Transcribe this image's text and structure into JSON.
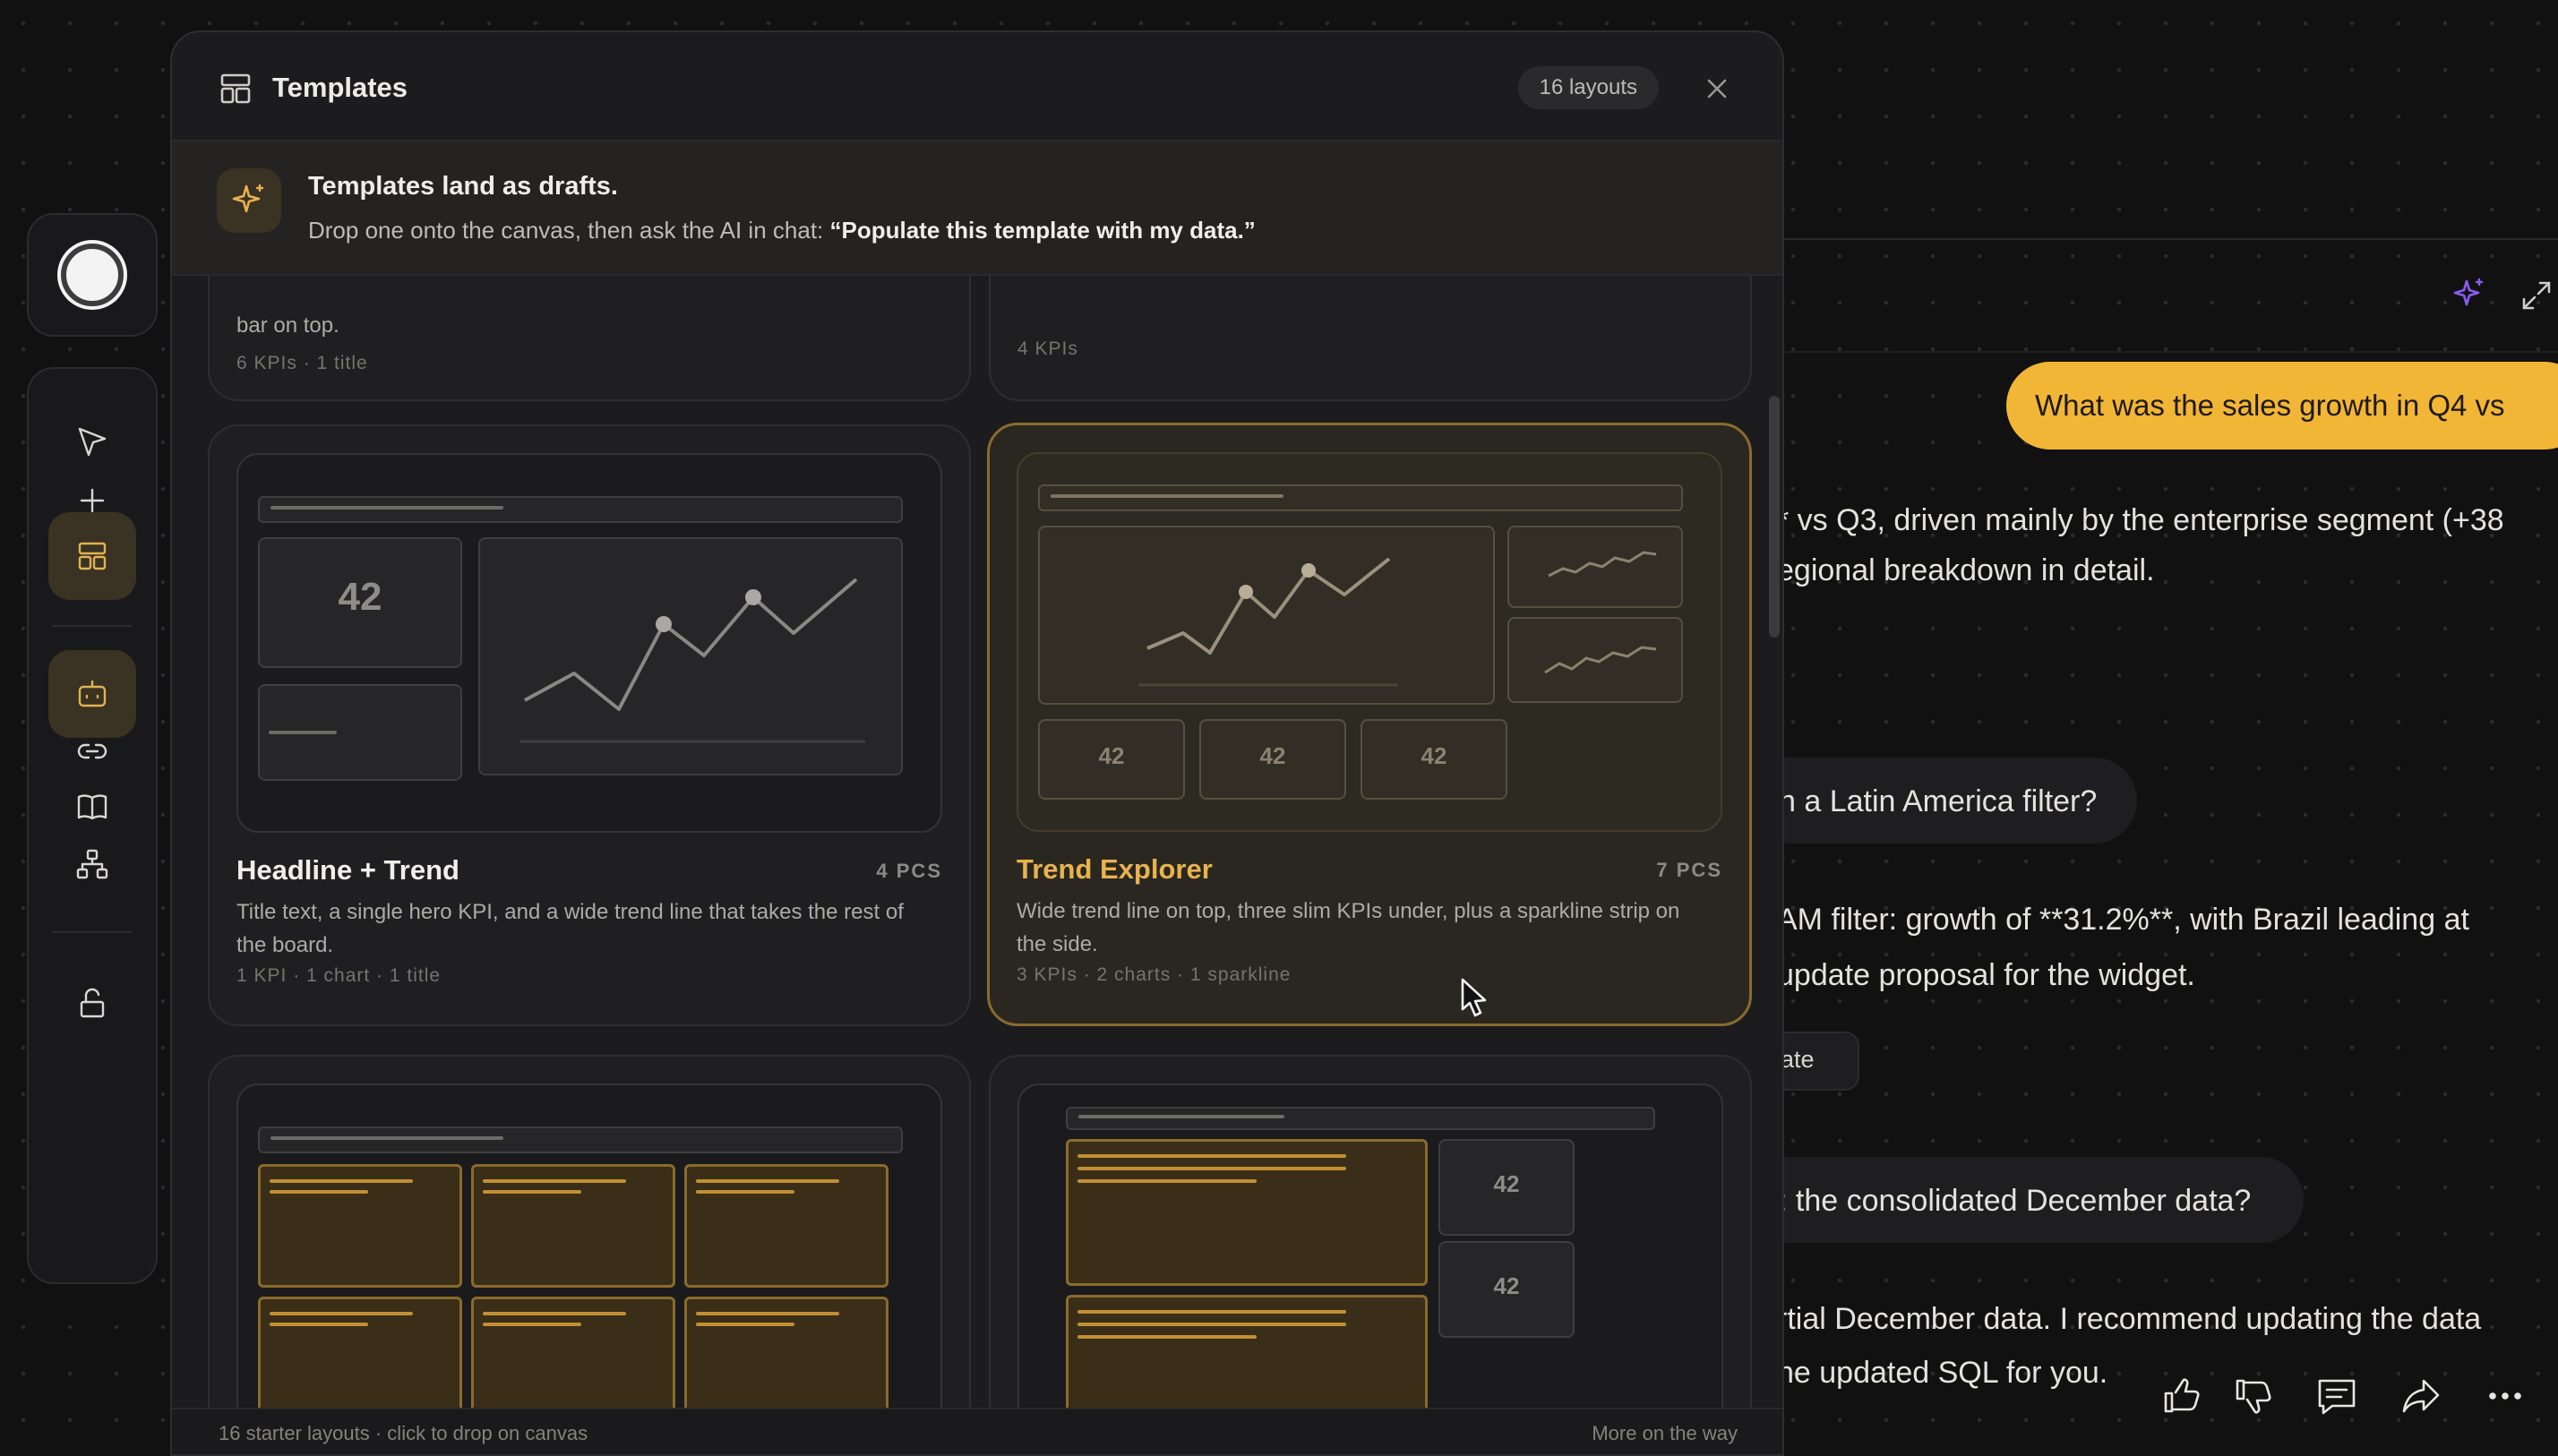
{
  "modal": {
    "title": "Templates",
    "layout_count": "16 layouts",
    "banner_title": "Templates land as drafts.",
    "banner_text": "Drop one onto the canvas, then ask the AI in chat:",
    "banner_quote": "“Populate this template with my data.”",
    "footer_left": "16 starter layouts · click to drop on canvas",
    "footer_right": "More on the way"
  },
  "partial_cards": [
    {
      "desc_tail": "bar on top.",
      "meta": "6 KPIs · 1 title"
    },
    {
      "meta": "4 KPIs"
    }
  ],
  "cards": [
    {
      "title": "Headline + Trend",
      "pieces": "4 PCS",
      "desc": "Title text, a single hero KPI, and a wide trend line that takes the rest of the board.",
      "meta": "1 KPI · 1 chart · 1 title",
      "kpi": "42"
    },
    {
      "title": "Trend Explorer",
      "pieces": "7 PCS",
      "desc": "Wide trend line on top, three slim KPIs under, plus a sparkline strip on the side.",
      "meta": "3 KPIs · 2 charts · 1 sparkline",
      "kpi": "42",
      "selected": true
    }
  ],
  "bottom_cards": [
    {
      "kpi": "42"
    }
  ],
  "chat": {
    "user_question": "What was the sales growth in Q4 vs",
    "answer_line1": "* vs Q3, driven mainly by the enterprise segment (+38",
    "answer_line2": "egional breakdown in detail.",
    "user_q2": "n a Latin America filter?",
    "answer2_line1": "AM filter: growth of **31.2%**, with Brazil leading at",
    "answer2_line2": " update proposal for the widget.",
    "chip": "ate",
    "user_q3": ": the consolidated December data?",
    "answer3_line1": "rtial December data. I recommend updating the data",
    "answer3_line2": "he updated SQL for you."
  },
  "icons": {
    "rail": [
      "pointer-icon",
      "plus-icon",
      "templates-icon",
      "bot-icon",
      "link-icon",
      "book-icon",
      "hierarchy-icon",
      "unlock-icon"
    ],
    "accent": "#f2b636",
    "selected_border": "#8a6b2e"
  }
}
